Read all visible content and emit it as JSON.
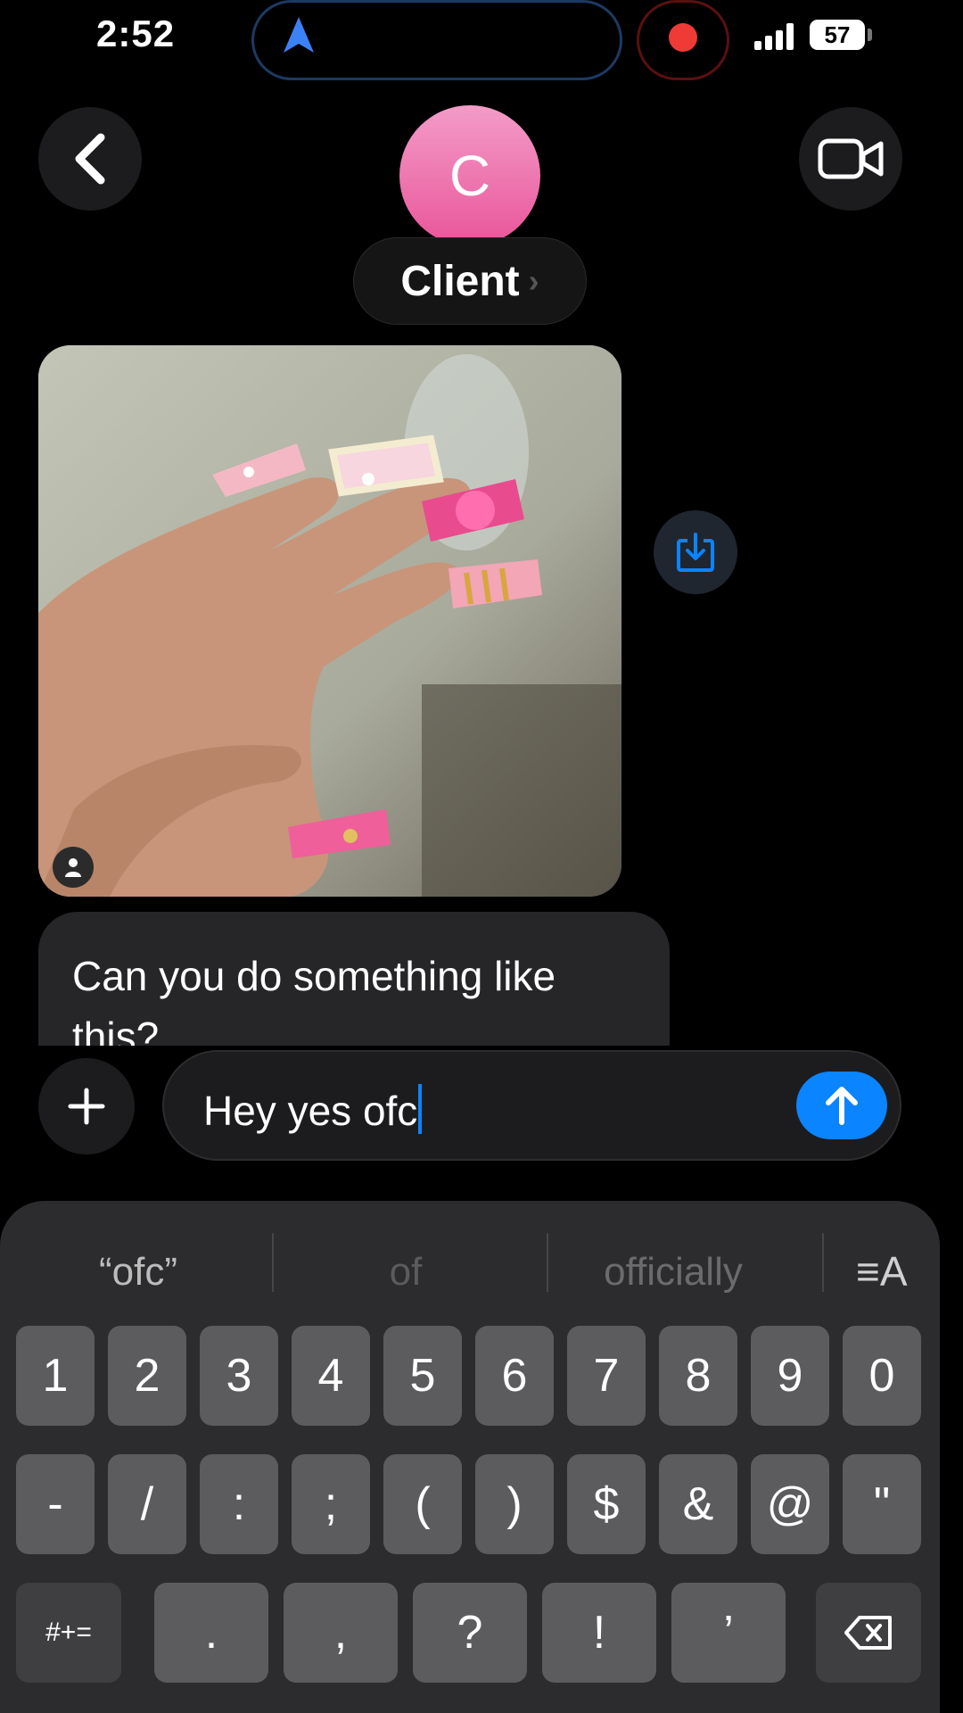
{
  "status_bar": {
    "time": "2:52",
    "battery": "57",
    "nav_icon": "location-arrow-icon",
    "recording_color": "#ef3a35"
  },
  "header": {
    "back_icon": "chevron-left-icon",
    "video_icon": "video-camera-icon",
    "avatar_initial": "C",
    "contact_name": "Client",
    "contact_chevron": "›"
  },
  "messages": {
    "photo_alt_icon": "person-icon",
    "save_icon": "save-to-photos-icon",
    "text": "Can you do something like this?"
  },
  "composer": {
    "plus_label": "+",
    "input_value": "Hey yes ofc",
    "send_icon": "arrow-up-icon",
    "accent": "#0a84ff"
  },
  "keyboard": {
    "suggestions": [
      "“ofc”",
      "of",
      "officially"
    ],
    "format_label": "≡A",
    "row1": [
      "1",
      "2",
      "3",
      "4",
      "5",
      "6",
      "7",
      "8",
      "9",
      "0"
    ],
    "row2": [
      "-",
      "/",
      ":",
      ";",
      "(",
      ")",
      "$",
      "&",
      "@",
      "\""
    ],
    "row3": {
      "shift": "#+=",
      "keys": [
        ".",
        ",",
        "?",
        "!",
        "’"
      ],
      "delete_icon": "backspace-icon"
    }
  }
}
